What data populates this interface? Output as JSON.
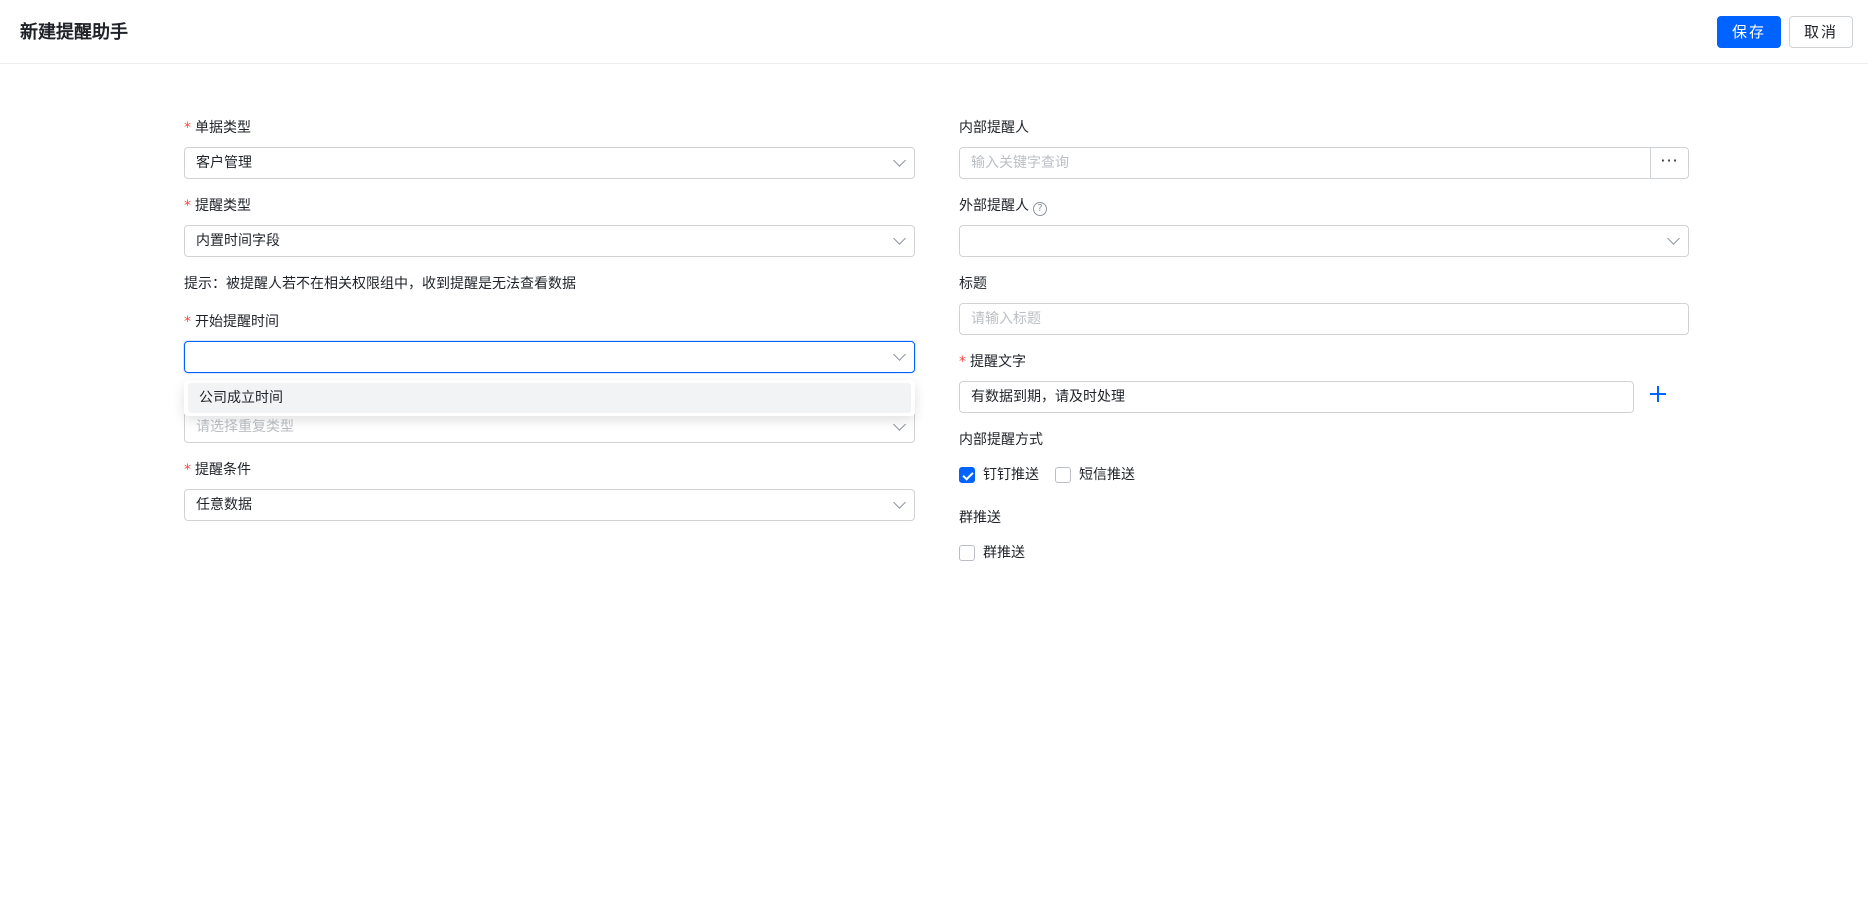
{
  "header": {
    "title": "新建提醒助手",
    "save_label": "保存",
    "cancel_label": "取消"
  },
  "left": {
    "doc_type": {
      "label": "单据类型",
      "value": "客户管理"
    },
    "remind_type": {
      "label": "提醒类型",
      "value": "内置时间字段"
    },
    "hint": "提示：被提醒人若不在相关权限组中，收到提醒是无法查看数据",
    "start_time": {
      "label": "开始提醒时间",
      "value": ""
    },
    "start_time_options": [
      "公司成立时间"
    ],
    "repeat_type": {
      "placeholder": "请选择重复类型"
    },
    "condition": {
      "label": "提醒条件",
      "value": "任意数据"
    }
  },
  "right": {
    "internal_reminder": {
      "label": "内部提醒人",
      "placeholder": "输入关键字查询",
      "more": "···"
    },
    "external_reminder": {
      "label": "外部提醒人",
      "help": "?"
    },
    "title": {
      "label": "标题",
      "placeholder": "请输入标题"
    },
    "remind_text": {
      "label": "提醒文字",
      "value": "有数据到期，请及时处理"
    },
    "internal_method": {
      "label": "内部提醒方式",
      "options": [
        {
          "label": "钉钉推送",
          "checked": true
        },
        {
          "label": "短信推送",
          "checked": false
        }
      ]
    },
    "group_push": {
      "label": "群推送",
      "option": {
        "label": "群推送",
        "checked": false
      }
    }
  },
  "colors": {
    "primary": "#0063ff",
    "required": "#f54a45",
    "border": "#d0d3d6",
    "placeholder": "#bbbfc4"
  },
  "icons": [
    "chevron-down-icon",
    "ellipsis-icon",
    "question-circle-icon",
    "plus-icon",
    "checkbox-checked-icon"
  ]
}
